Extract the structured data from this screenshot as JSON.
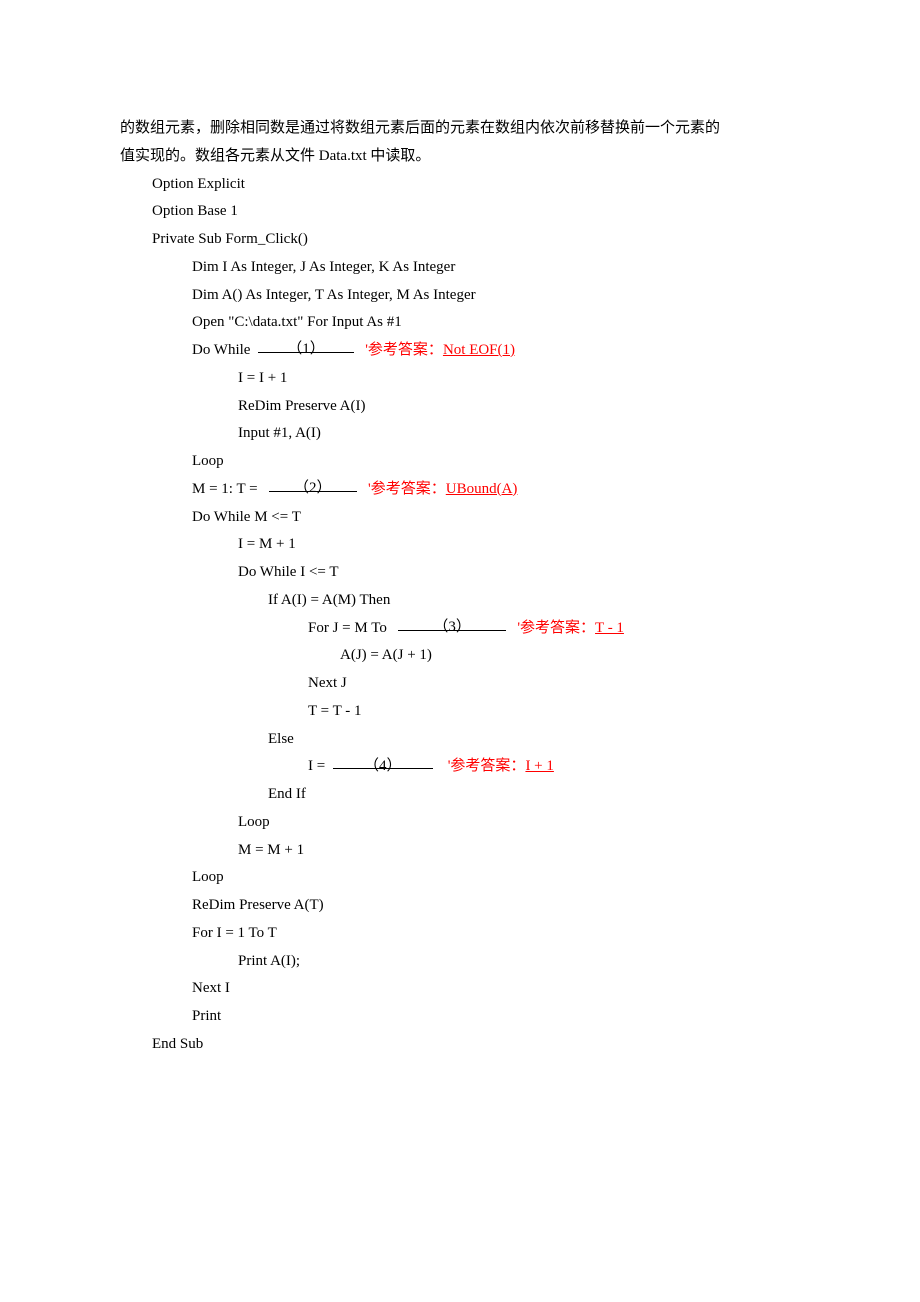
{
  "paragraph": {
    "l1": "的数组元素，删除相同数是通过将数组元素后面的元素在数组内依次前移替换前一个元素的",
    "l2": "值实现的。数组各元素从文件 Data.txt 中读取。"
  },
  "code": {
    "c01": "Option Explicit",
    "c02": "Option Base 1",
    "c03": "Private Sub Form_Click()",
    "c04": "Dim I As Integer, J As Integer, K As Integer",
    "c05": "Dim A() As Integer, T As Integer, M As Integer",
    "c06": "Open \"C:\\data.txt\" For Input As #1",
    "c07a": "Do While  ",
    "c07num": "（1）",
    "c07b": "   '参考答案：",
    "c07ans": "Not EOF(1)",
    "c08": "I = I + 1",
    "c09": "ReDim Preserve A(I)",
    "c10": "Input #1, A(I)",
    "c11": "Loop",
    "c12a": "M = 1: T =   ",
    "c12num": "（2）",
    "c12b": "   '参考答案：",
    "c12ans": "UBound(A)",
    "c13": "Do While M <= T",
    "c14": "I = M + 1",
    "c15": "Do While I <= T",
    "c16": "If A(I) = A(M) Then",
    "c17a": "For J = M To   ",
    "c17num": "（3）",
    "c17b": "   '参考答案：",
    "c17ans": "T - 1",
    "c18": "A(J) = A(J + 1)",
    "c19": "Next J",
    "c20": "T = T - 1",
    "c21": "Else",
    "c22a": "I =  ",
    "c22num": "（4）",
    "c22b": "    '参考答案：",
    "c22ans": "I + 1",
    "c23": "End If",
    "c24": "Loop",
    "c25": "M = M + 1",
    "c26": "Loop",
    "c27": "ReDim Preserve A(T)",
    "c28": "For I = 1 To T",
    "c29": "Print A(I);",
    "c30": "Next I",
    "c31": "Print",
    "c32": "End Sub"
  }
}
